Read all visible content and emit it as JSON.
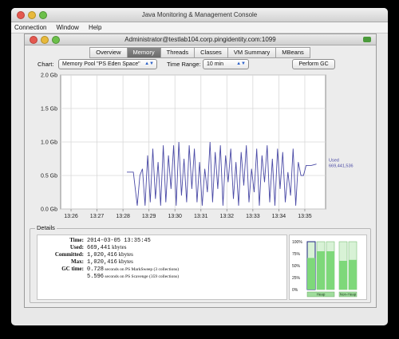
{
  "window": {
    "title": "Java Monitoring & Management Console",
    "menu": [
      "Connection",
      "Window",
      "Help"
    ],
    "connection_title": "Administrator@testlab104.corp.pingidentity.com:1099"
  },
  "tabs": [
    "Overview",
    "Memory",
    "Threads",
    "Classes",
    "VM Summary",
    "MBeans"
  ],
  "active_tab": "Memory",
  "controls": {
    "chart_label": "Chart:",
    "chart_value": "Memory Pool \"PS Eden Space\"",
    "time_range_label": "Time Range:",
    "time_range_value": "10 min",
    "gc_button": "Perform GC"
  },
  "chart_data": {
    "type": "line",
    "title": "",
    "ylabel": "",
    "xlabel": "",
    "y_ticks": [
      "2.0 Gb",
      "1.5 Gb",
      "1.0 Gb",
      "0.5 Gb",
      "0.0 Gb"
    ],
    "ylim_gb": [
      0,
      2.0
    ],
    "x_ticks": [
      "13:26",
      "13:27",
      "13:28",
      "13:29",
      "13:30",
      "13:31",
      "13:32",
      "13:33",
      "13:34",
      "13:35"
    ],
    "grid": true,
    "series": [
      {
        "name": "Used",
        "color": "#4a4aa6",
        "annotation_label": "Used",
        "annotation_value": "669,441,536",
        "x_minutes": [
          28.15,
          28.4,
          28.55,
          28.65,
          28.75,
          28.85,
          28.95,
          29.05,
          29.15,
          29.25,
          29.35,
          29.45,
          29.55,
          29.65,
          29.75,
          29.85,
          29.95,
          30.05,
          30.15,
          30.25,
          30.35,
          30.45,
          30.55,
          30.65,
          30.75,
          30.85,
          30.95,
          31.05,
          31.15,
          31.25,
          31.35,
          31.45,
          31.55,
          31.65,
          31.75,
          31.85,
          31.95,
          32.05,
          32.15,
          32.25,
          32.35,
          32.45,
          32.55,
          32.65,
          32.75,
          32.85,
          32.95,
          33.05,
          33.15,
          33.25,
          33.35,
          33.45,
          33.55,
          33.65,
          33.75,
          33.85,
          33.95,
          34.05,
          34.15,
          34.25,
          34.35,
          34.45,
          34.55,
          34.65,
          34.75,
          34.85,
          34.95,
          35.05,
          35.25,
          35.45
        ],
        "y_gb": [
          0.55,
          0.55,
          0.05,
          0.5,
          0.6,
          0.05,
          0.8,
          0.1,
          0.9,
          0.15,
          0.7,
          0.05,
          0.95,
          0.1,
          0.8,
          0.3,
          0.95,
          0.05,
          1.0,
          0.2,
          0.75,
          0.1,
          0.95,
          0.3,
          0.9,
          0.1,
          0.7,
          0.05,
          0.6,
          0.25,
          1.0,
          0.1,
          0.85,
          0.3,
          0.95,
          0.05,
          0.8,
          0.4,
          0.9,
          0.15,
          0.7,
          0.05,
          0.85,
          0.35,
          0.95,
          0.1,
          0.6,
          0.25,
          0.9,
          0.05,
          0.8,
          0.4,
          0.95,
          0.1,
          0.75,
          0.05,
          0.9,
          0.3,
          0.85,
          0.1,
          0.55,
          0.2,
          0.9,
          0.05,
          0.7,
          0.5,
          0.5,
          0.65,
          0.65,
          0.67
        ]
      }
    ]
  },
  "details": {
    "title": "Details",
    "rows": [
      {
        "key": "Time:",
        "value": "2014-03-05 13:35:45",
        "unit": ""
      },
      {
        "key": "Used:",
        "value": "669,441",
        "unit": "kbytes"
      },
      {
        "key": "Committed:",
        "value": "1,020,416",
        "unit": "kbytes"
      },
      {
        "key": "Max:",
        "value": "1,020,416",
        "unit": "kbytes"
      },
      {
        "key": "GC time:",
        "value": "0.728",
        "unit": "seconds on PS MarkSweep (3 collections)"
      },
      {
        "key": "",
        "value": "5.596",
        "unit": "seconds on PS Scavenge (359 collections)"
      }
    ]
  },
  "gc_bars": {
    "y_labels": [
      "100%",
      "75%",
      "50%",
      "25%",
      "0%"
    ],
    "group_labels": [
      "Heap",
      "Non-Heap"
    ],
    "levels": [
      0.66,
      0.8,
      0.8,
      0.6,
      0.62
    ],
    "fill_color": "#7ed87a",
    "selected_color": "#1a237e"
  }
}
